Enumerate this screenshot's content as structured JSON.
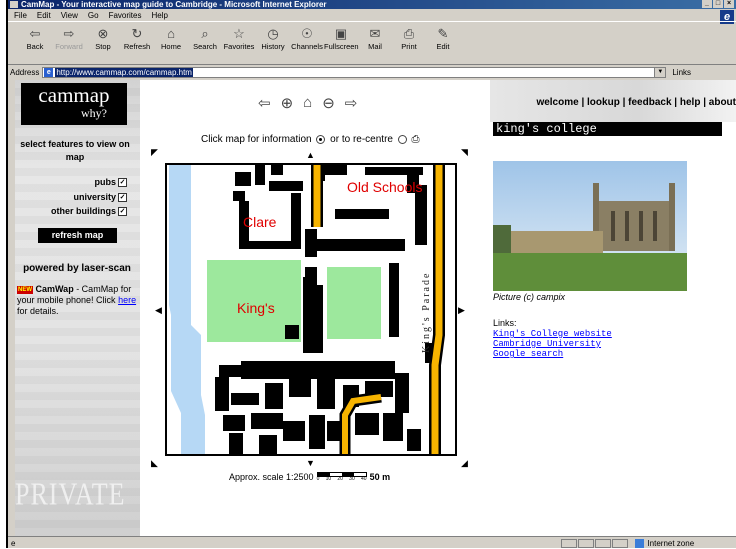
{
  "window": {
    "title": "CamMap - Your interactive map guide to Cambridge - Microsoft Internet Explorer",
    "min": "_",
    "max": "□",
    "close": "×"
  },
  "menu": [
    "File",
    "Edit",
    "View",
    "Go",
    "Favorites",
    "Help"
  ],
  "toolbar": [
    {
      "label": "Back",
      "icon": "back-arrow-icon",
      "glyph": "⇦",
      "enabled": true
    },
    {
      "label": "Forward",
      "icon": "forward-arrow-icon",
      "glyph": "⇨",
      "enabled": false
    },
    {
      "label": "Stop",
      "icon": "stop-icon",
      "glyph": "⊗",
      "enabled": true
    },
    {
      "label": "Refresh",
      "icon": "refresh-icon",
      "glyph": "↻",
      "enabled": true
    },
    {
      "label": "Home",
      "icon": "home-icon",
      "glyph": "⌂",
      "enabled": true
    },
    {
      "label": "Search",
      "icon": "search-icon",
      "glyph": "⌕",
      "enabled": true
    },
    {
      "label": "Favorites",
      "icon": "favorites-icon",
      "glyph": "☆",
      "enabled": true
    },
    {
      "label": "History",
      "icon": "history-icon",
      "glyph": "◷",
      "enabled": true
    },
    {
      "label": "Channels",
      "icon": "channels-icon",
      "glyph": "☉",
      "enabled": true
    },
    {
      "label": "Fullscreen",
      "icon": "fullscreen-icon",
      "glyph": "▣",
      "enabled": true
    },
    {
      "label": "Mail",
      "icon": "mail-icon",
      "glyph": "✉",
      "enabled": true
    },
    {
      "label": "Print",
      "icon": "print-icon",
      "glyph": "⎙",
      "enabled": true
    },
    {
      "label": "Edit",
      "icon": "edit-icon",
      "glyph": "✎",
      "enabled": true
    }
  ],
  "address": {
    "label": "Address",
    "url": "http://www.cammap.com/cammap.htm",
    "links": "Links"
  },
  "status": {
    "zone": "Internet zone"
  },
  "page": {
    "logo": "cammap",
    "logo_sub": "why?",
    "features_title": "select features to view on map",
    "features": [
      {
        "label": "pubs",
        "checked": true
      },
      {
        "label": "university",
        "checked": true
      },
      {
        "label": "other buildings",
        "checked": true
      }
    ],
    "check_mark": "✓",
    "refresh_button": "refresh map",
    "powered_by": "powered by laser-scan",
    "camwap_badge": "NEW",
    "camwap_name": "CamWap",
    "camwap_text": " - CamMap for your mobile phone! Click ",
    "camwap_link": "here",
    "camwap_end": " for details.",
    "watermark": "PRIVATE",
    "click_text": "Click map for information",
    "recentre_text": "or to re-centre",
    "map_labels": {
      "old_schools": "Old Schools",
      "clare": "Clare",
      "kings": "King's",
      "kings_parade": "King's Parade"
    },
    "scale_text": "Approx. scale 1:2500",
    "scale_ticks": [
      "0",
      "10",
      "20",
      "30",
      "40"
    ],
    "scale_end": "50 m",
    "top_nav": "welcome | lookup | feedback | help | about",
    "place": "king's college",
    "photo_credit": "Picture (c) campix",
    "links_label": "Links:",
    "links": [
      "King's College website",
      "Cambridge University",
      "Google search"
    ]
  },
  "colors": {
    "titlebar": "#0a246a",
    "grass": "#9de89d",
    "water": "#b6d8f5",
    "road": "#f7b400",
    "map_label": "#e00000"
  }
}
